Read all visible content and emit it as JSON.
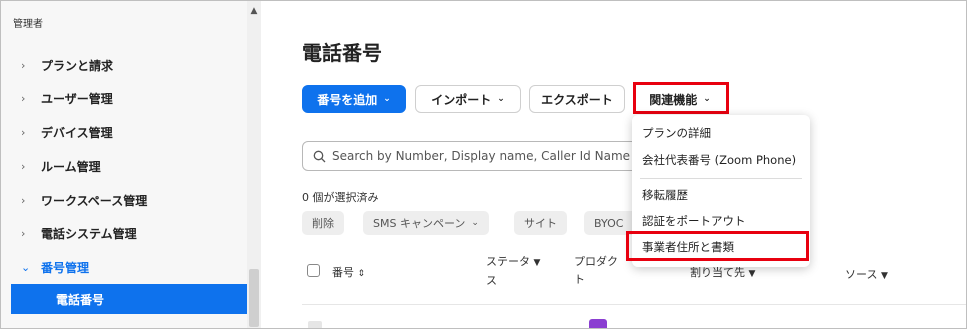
{
  "sidebar": {
    "section_label": "管理者",
    "items": [
      {
        "label": "プランと請求",
        "chevron": "›"
      },
      {
        "label": "ユーザー管理",
        "chevron": "›"
      },
      {
        "label": "デバイス管理",
        "chevron": "›"
      },
      {
        "label": "ルーム管理",
        "chevron": "›"
      },
      {
        "label": "ワークスペース管理",
        "chevron": "›"
      },
      {
        "label": "電話システム管理",
        "chevron": "›"
      },
      {
        "label": "番号管理",
        "chevron": "⌄"
      }
    ],
    "active_subitem": "電話番号"
  },
  "main": {
    "title": "電話番号",
    "toolbar": {
      "add_number": "番号を追加",
      "import": "インポート",
      "export": "エクスポート",
      "related": "関連機能"
    },
    "search": {
      "placeholder": "Search by Number, Display name, Caller Id Name"
    },
    "selected_count": "0 個が選択済み",
    "bulk_actions": {
      "delete": "削除",
      "sms_campaign": "SMS キャンペーン",
      "site": "サイト",
      "byoc": "BYOC"
    },
    "table_headers": {
      "number": "番号",
      "status_line1": "ステータ",
      "status_line2": "ス",
      "product_line1": "プロダク",
      "product_line2": "ト",
      "assigned_to": "割り当て先",
      "source": "ソース"
    }
  },
  "related_menu": {
    "items": [
      "プランの詳細",
      "会社代表番号 (Zoom Phone)",
      "移転履歴",
      "認証をポートアウト",
      "事業者住所と書類"
    ]
  },
  "colors": {
    "primary": "#0e72ed",
    "highlight_border": "#e8000f",
    "product_badge": "#8b3fd1"
  }
}
